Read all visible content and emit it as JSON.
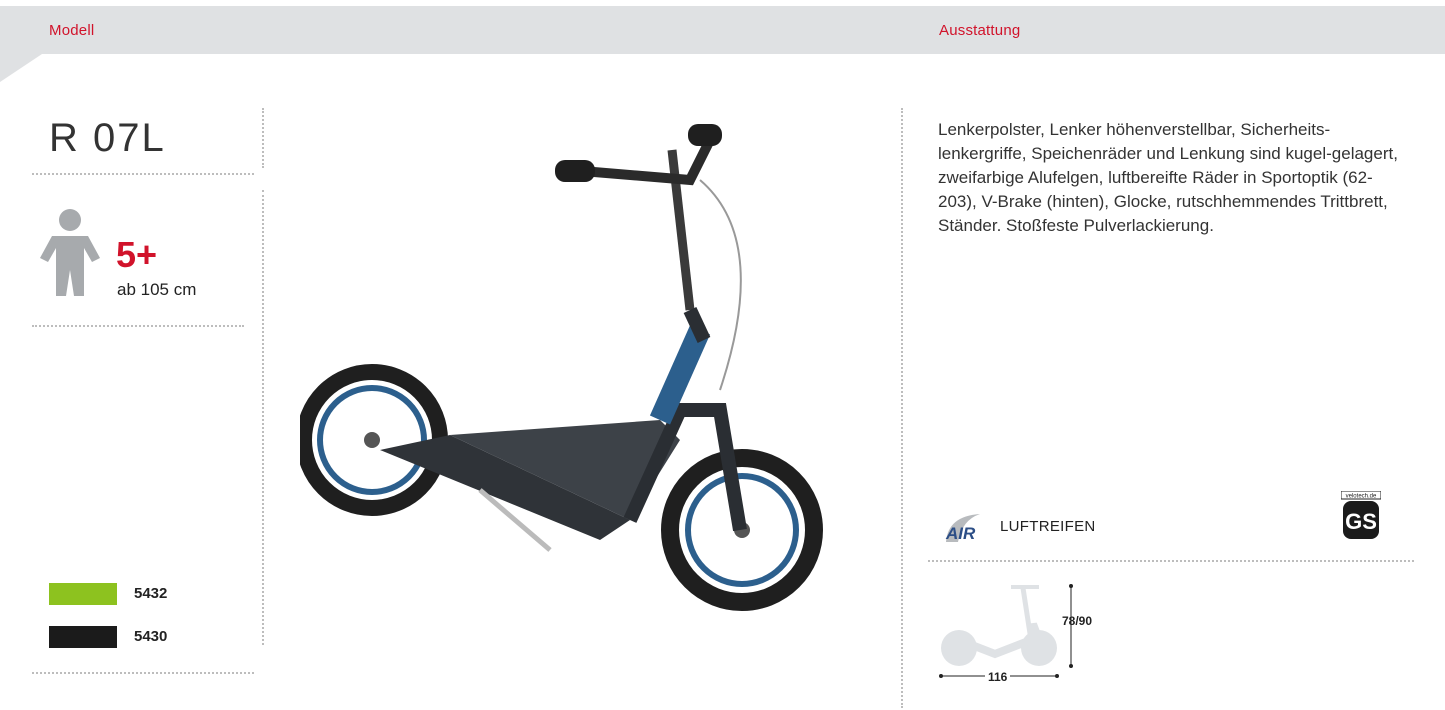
{
  "header": {
    "left_label": "Modell",
    "right_label": "Ausstattung"
  },
  "product": {
    "model": "R 07L",
    "age": "5+",
    "min_height": "ab 105 cm",
    "variants": [
      {
        "code": "5432",
        "color": "#8dc21f"
      },
      {
        "code": "5430",
        "color": "#1b1b1b"
      }
    ]
  },
  "features": {
    "description": "Lenkerpolster, Lenker höhenverstellbar, Sicherheits-lenkergriffe, Speichenräder und Lenkung sind kugel-gelagert, zweifarbige Alufelgen, luftbereifte Räder in Sportoptik (62-203), V-Brake (hinten), Glocke, rutschhemmendes Trittbrett, Ständer. Stoßfeste Pulverlackierung.",
    "air_logo_text": "AIR",
    "air_label": "LUFTREIFEN",
    "gs_logo_text": "GS",
    "gs_top_text": "velotech.de"
  },
  "dimensions": {
    "height": "78/90",
    "length": "116"
  },
  "colors": {
    "accent": "#d1132b",
    "band": "#dfe1e3",
    "icon_grey": "#a7aaad",
    "scooter_blue": "#2c5f8d"
  }
}
